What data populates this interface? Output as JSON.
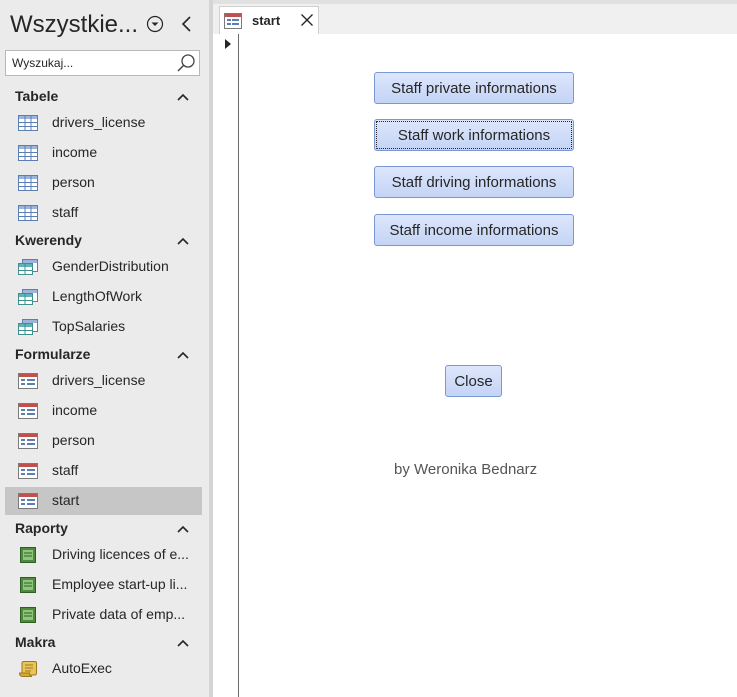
{
  "nav": {
    "title": "Wszystkie...",
    "search_placeholder": "Wyszukaj...",
    "groups": [
      {
        "label": "Tabele",
        "items": [
          {
            "label": "drivers_license",
            "icon": "table-icon"
          },
          {
            "label": "income",
            "icon": "table-icon"
          },
          {
            "label": "person",
            "icon": "table-icon"
          },
          {
            "label": "staff",
            "icon": "table-icon"
          }
        ]
      },
      {
        "label": "Kwerendy",
        "items": [
          {
            "label": "GenderDistribution",
            "icon": "query-icon"
          },
          {
            "label": "LengthOfWork",
            "icon": "query-icon"
          },
          {
            "label": "TopSalaries",
            "icon": "query-icon"
          }
        ]
      },
      {
        "label": "Formularze",
        "items": [
          {
            "label": "drivers_license",
            "icon": "form-icon"
          },
          {
            "label": "income",
            "icon": "form-icon"
          },
          {
            "label": "person",
            "icon": "form-icon"
          },
          {
            "label": "staff",
            "icon": "form-icon"
          },
          {
            "label": "start",
            "icon": "form-icon",
            "selected": true
          }
        ]
      },
      {
        "label": "Raporty",
        "items": [
          {
            "label": "Driving licences of e...",
            "icon": "report-icon"
          },
          {
            "label": "Employee start-up li...",
            "icon": "report-icon"
          },
          {
            "label": "Private data of emp...",
            "icon": "report-icon"
          }
        ]
      },
      {
        "label": "Makra",
        "items": [
          {
            "label": "AutoExec",
            "icon": "macro-icon"
          }
        ]
      }
    ]
  },
  "tab": {
    "label": "start",
    "icon": "form-icon"
  },
  "form": {
    "buttons": {
      "private": "Staff private informations",
      "work": "Staff work informations",
      "driving": "Staff driving informations",
      "income": "Staff income informations",
      "close": "Close"
    },
    "footer": "by Weronika Bednarz"
  },
  "colors": {
    "pane_bg": "#ebebeb",
    "selected_item_bg": "#c6c6c6",
    "button_fill": "#c4d4f6",
    "button_border": "#7b98d6",
    "form_tab_icon_accent": "#c0504d",
    "report_icon_green": "#4e8a3e"
  }
}
